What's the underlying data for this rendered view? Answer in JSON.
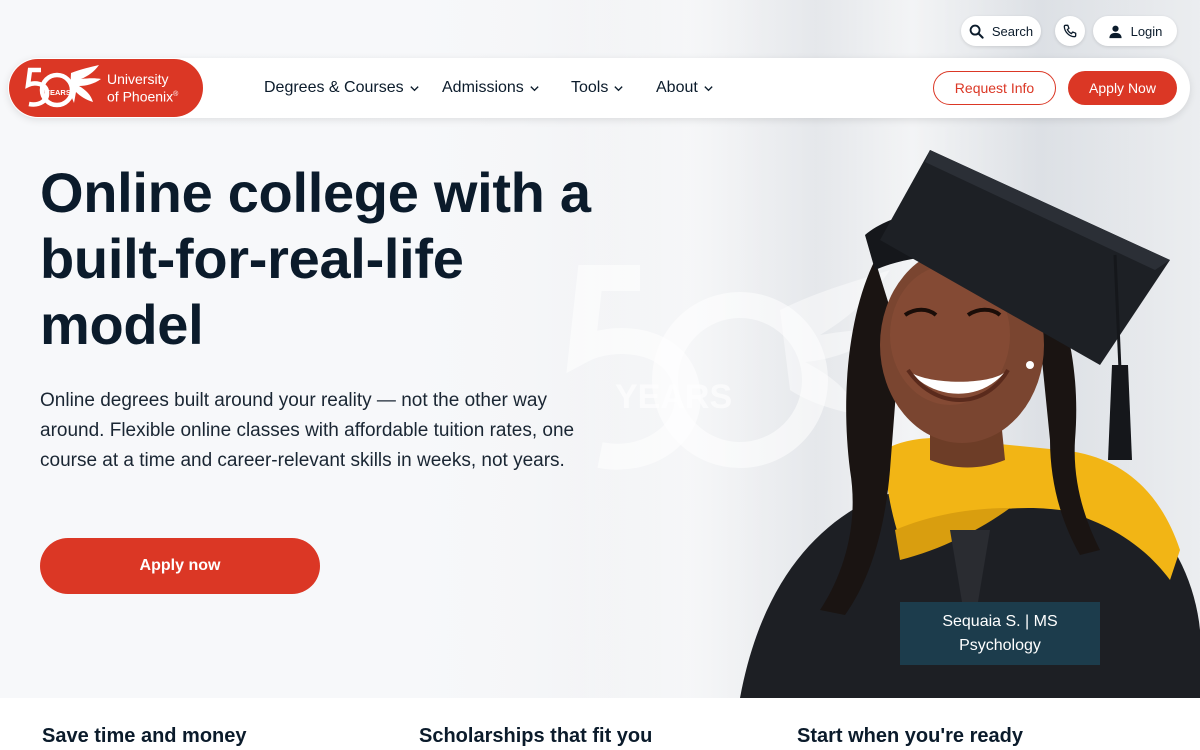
{
  "utility": {
    "search_label": "Search",
    "login_label": "Login"
  },
  "logo": {
    "badge": "50",
    "badge_sub": "YEARS",
    "line1": "University",
    "line2": "of Phoenix",
    "mark": "®"
  },
  "nav": {
    "items": [
      {
        "label": "Degrees & Courses"
      },
      {
        "label": "Admissions"
      },
      {
        "label": "Tools"
      },
      {
        "label": "About"
      }
    ],
    "request_info": "Request Info",
    "apply_now": "Apply Now"
  },
  "hero": {
    "title": "Online college with a built-for-real-life model",
    "subtitle": "Online degrees built around your reality — not the other way around. Flexible online classes with affordable tuition rates, one course at a time and career-relevant skills in weeks, not years.",
    "cta": "Apply now",
    "watermark_text": "YEARS",
    "caption_line1": "Sequaia S. | MS",
    "caption_line2": "Psychology"
  },
  "features": [
    {
      "title": "Save time and money"
    },
    {
      "title": "Scholarships that fit you"
    },
    {
      "title": "Start when you're ready"
    }
  ],
  "colors": {
    "brand_red": "#db3725",
    "caption_bg": "#1c3c4c",
    "text_dark": "#0b1b2b"
  },
  "icons": [
    "search-icon",
    "phone-icon",
    "user-icon",
    "chevron-down-icon"
  ]
}
